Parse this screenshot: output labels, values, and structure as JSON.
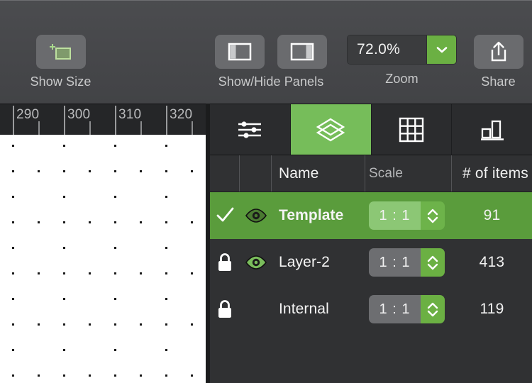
{
  "toolbar": {
    "show_size": {
      "label": "Show Size",
      "icon": "size-rect-icon"
    },
    "panels": {
      "label": "Show/Hide Panels",
      "left_button_icon": "panel-left-icon",
      "right_button_icon": "panel-right-icon"
    },
    "zoom": {
      "label": "Zoom",
      "value": "72.0%",
      "dropdown_icon": "chevron-down-icon"
    },
    "share": {
      "label": "Share",
      "icon": "share-icon"
    }
  },
  "ruler": {
    "labels": [
      "290",
      "300",
      "310",
      "320"
    ],
    "major_ticks_x": [
      18,
      90,
      162,
      234
    ],
    "minor_ticks_x": [
      54,
      126,
      198,
      270
    ]
  },
  "canvas": {
    "background": "#ffffff",
    "dot_color": "#1a1a1a",
    "grid_spacing": 36
  },
  "panel": {
    "tabs": [
      {
        "name": "tab-settings",
        "icon": "sliders-icon",
        "active": false
      },
      {
        "name": "tab-layers",
        "icon": "layers-icon",
        "active": true
      },
      {
        "name": "tab-grid",
        "icon": "grid-icon",
        "active": false
      },
      {
        "name": "tab-chart",
        "icon": "chart-icon",
        "active": false
      }
    ],
    "columns": [
      {
        "key": "check",
        "label": ""
      },
      {
        "key": "eye",
        "label": ""
      },
      {
        "key": "name",
        "label": "Name"
      },
      {
        "key": "scale",
        "label": "Scale"
      },
      {
        "key": "items",
        "label": "# of items"
      }
    ],
    "rows": [
      {
        "name": "Template",
        "scale": "1 : 1",
        "items": "91",
        "selected": true,
        "status_icon": "checkmark-icon",
        "visibility_icon": "eye-icon",
        "visible": true
      },
      {
        "name": "Layer-2",
        "scale": "1 : 1",
        "items": "413",
        "selected": false,
        "status_icon": "lock-icon",
        "visibility_icon": "eye-icon",
        "visible": true
      },
      {
        "name": "Internal",
        "scale": "1 : 1",
        "items": "119",
        "selected": false,
        "status_icon": "lock-icon",
        "visibility_icon": "none",
        "visible": false
      }
    ]
  },
  "colors": {
    "accent_green": "#76bd5a",
    "button_green": "#6bb043",
    "row_selected": "#5a9c3c",
    "toolbar_bg": "#46474a",
    "panel_bg": "#303133"
  }
}
